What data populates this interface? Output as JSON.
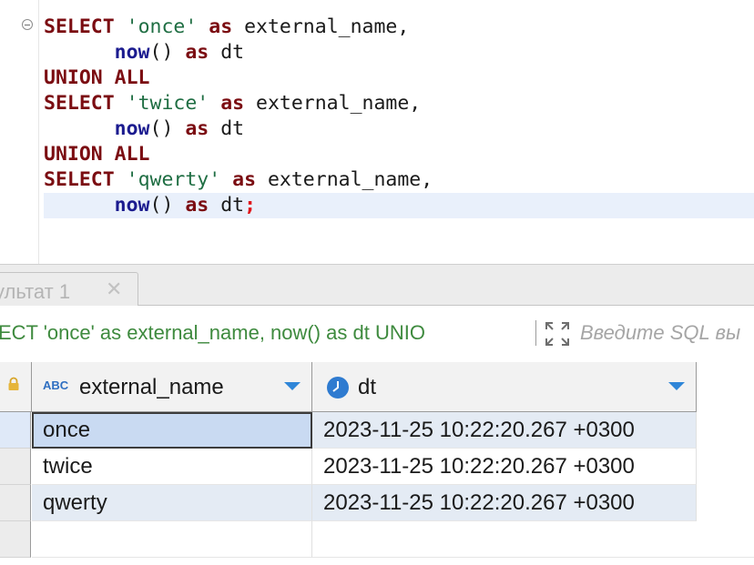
{
  "editor": {
    "lines": [
      {
        "parts": [
          {
            "c": "kw",
            "t": "SELECT"
          },
          {
            "c": "",
            "t": " "
          },
          {
            "c": "str",
            "t": "'once'"
          },
          {
            "c": "",
            "t": " "
          },
          {
            "c": "kw",
            "t": "as"
          },
          {
            "c": "",
            "t": " external_name,"
          }
        ]
      },
      {
        "parts": [
          {
            "c": "",
            "t": "      "
          },
          {
            "c": "fn",
            "t": "now"
          },
          {
            "c": "",
            "t": "() "
          },
          {
            "c": "kw",
            "t": "as"
          },
          {
            "c": "",
            "t": " dt"
          }
        ]
      },
      {
        "parts": [
          {
            "c": "kw",
            "t": "UNION ALL"
          }
        ]
      },
      {
        "parts": [
          {
            "c": "kw",
            "t": "SELECT"
          },
          {
            "c": "",
            "t": " "
          },
          {
            "c": "str",
            "t": "'twice'"
          },
          {
            "c": "",
            "t": " "
          },
          {
            "c": "kw",
            "t": "as"
          },
          {
            "c": "",
            "t": " external_name,"
          }
        ]
      },
      {
        "parts": [
          {
            "c": "",
            "t": "      "
          },
          {
            "c": "fn",
            "t": "now"
          },
          {
            "c": "",
            "t": "() "
          },
          {
            "c": "kw",
            "t": "as"
          },
          {
            "c": "",
            "t": " dt"
          }
        ]
      },
      {
        "parts": [
          {
            "c": "kw",
            "t": "UNION ALL"
          }
        ]
      },
      {
        "parts": [
          {
            "c": "kw",
            "t": "SELECT"
          },
          {
            "c": "",
            "t": " "
          },
          {
            "c": "str",
            "t": "'qwerty'"
          },
          {
            "c": "",
            "t": " "
          },
          {
            "c": "kw",
            "t": "as"
          },
          {
            "c": "",
            "t": " external_name,"
          }
        ]
      },
      {
        "parts": [
          {
            "c": "",
            "t": "      "
          },
          {
            "c": "fn",
            "t": "now"
          },
          {
            "c": "",
            "t": "() "
          },
          {
            "c": "kw",
            "t": "as"
          },
          {
            "c": "",
            "t": " dt"
          },
          {
            "c": "semi",
            "t": ";"
          }
        ]
      }
    ]
  },
  "results": {
    "tab_label": "ультат 1",
    "tab_close": "✕",
    "filter_query": "ECT 'once' as external_name, now() as dt UNIO",
    "filter_placeholder": "Введите SQL вы",
    "columns": [
      {
        "badge": "ABC",
        "label": "external_name"
      },
      {
        "label": "dt"
      }
    ],
    "rows": [
      {
        "external_name": "once",
        "dt": "2023-11-25 10:22:20.267 +0300"
      },
      {
        "external_name": "twice",
        "dt": "2023-11-25 10:22:20.267 +0300"
      },
      {
        "external_name": "qwerty",
        "dt": "2023-11-25 10:22:20.267 +0300"
      }
    ]
  },
  "colors": {
    "keyword": "#7b0d12",
    "string": "#1f6e43",
    "function": "#1b1b8f",
    "semicolon": "#e0161b",
    "filter_text": "#3e8a3e",
    "accent": "#2f86d8"
  },
  "icons": {
    "fold": "collapse-minus-icon",
    "tab_close": "close-icon",
    "filter_expand": "expand-arrows-icon",
    "lock": "lock-icon",
    "text_type": "abc-type-icon",
    "datetime_type": "clock-icon",
    "sort": "chevron-down-icon"
  }
}
